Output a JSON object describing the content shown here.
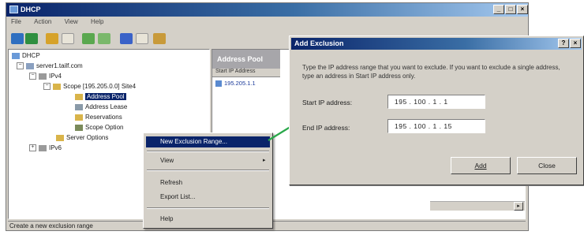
{
  "window": {
    "title": "DHCP"
  },
  "caption_buttons": [
    "_",
    "□",
    "×"
  ],
  "menu": [
    "File",
    "Action",
    "View",
    "Help"
  ],
  "toolbar_icons": [
    "back-icon",
    "forward-icon",
    "up-icon",
    "show-hide-tree-icon",
    "refresh-icon",
    "export-list-icon",
    "help-icon",
    "new-icon",
    "properties-icon"
  ],
  "tree": {
    "root": "DHCP",
    "server": "server1.tailf.com",
    "ipv4": "IPv4",
    "scope": "Scope [195.205.0.0] Site4",
    "address_pool": "Address Pool",
    "address_leases": "Address Lease",
    "reservations": "Reservations",
    "scope_options": "Scope Option",
    "server_options": "Server Options",
    "ipv6": "IPv6"
  },
  "right_pane": {
    "header": "Address Pool",
    "column": "Start IP Address",
    "row": "195.205.1.1"
  },
  "status_text": "Create a new exclusion range",
  "context_menu": {
    "new_exclusion": "New Exclusion Range...",
    "view": "View",
    "refresh": "Refresh",
    "export": "Export List...",
    "help": "Help"
  },
  "dialog": {
    "title": "Add Exclusion",
    "help_glyph": "?",
    "close_glyph": "×",
    "instructions": "Type the IP address range that you want to exclude. If you want to exclude a single address, type an address in Start IP address only.",
    "start_label": "Start IP address:",
    "start_value": "195 . 100 .  1  .  1",
    "end_label": "End IP address:",
    "end_value": "195 . 100 .  1  .  15",
    "add_label": "Add",
    "close_label": "Close"
  },
  "colors": {
    "titlebar": "#0a246a",
    "face": "#d4d0c8",
    "highlight": "#0a246a",
    "arrow": "#2aa84a"
  }
}
